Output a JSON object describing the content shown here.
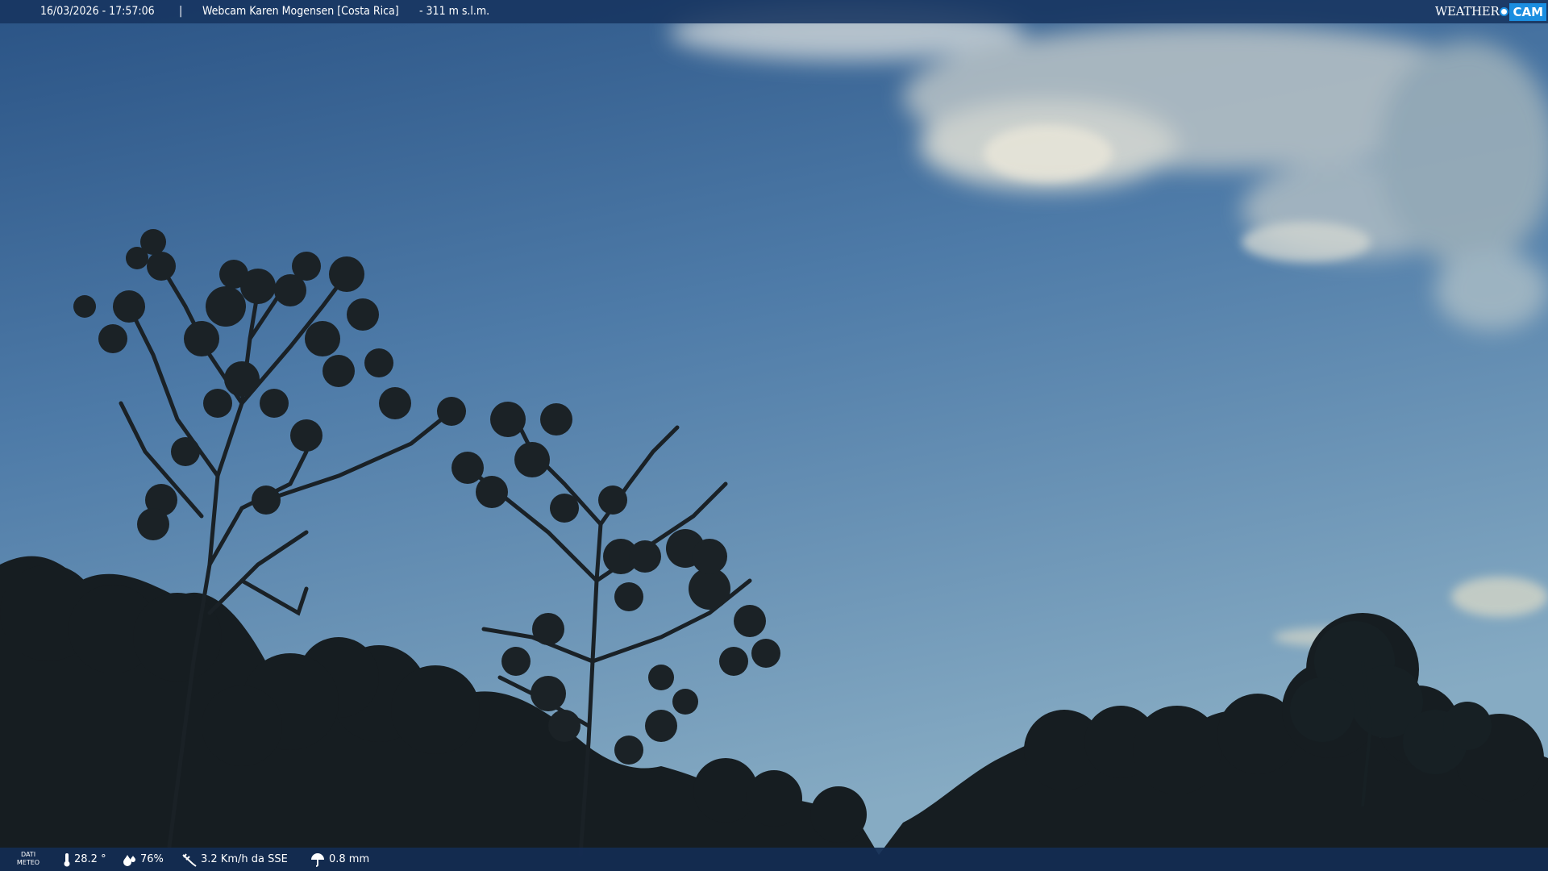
{
  "header": {
    "datetime": "16/03/2026 - 17:57:06",
    "separator": "|",
    "title": "Webcam Karen Mogensen [Costa Rica]",
    "altitude": "- 311 m s.l.m."
  },
  "brand": {
    "weather": "WEATHER",
    "cam": "CAM",
    "accent_color": "#1b8ee0"
  },
  "weather_bar": {
    "label_line1": "DATI",
    "label_line2": "METEO",
    "temperature": "28.2 °",
    "humidity": "76%",
    "wind": "3.2 Km/h da SSE",
    "rain": "0.8 mm"
  },
  "icons": [
    "thermometer-icon",
    "humidity-icon",
    "wind-icon",
    "rain-icon"
  ],
  "colors": {
    "sky_top": "#2b5588",
    "sky_bottom": "#7aa3bf",
    "bar": "#173460"
  }
}
